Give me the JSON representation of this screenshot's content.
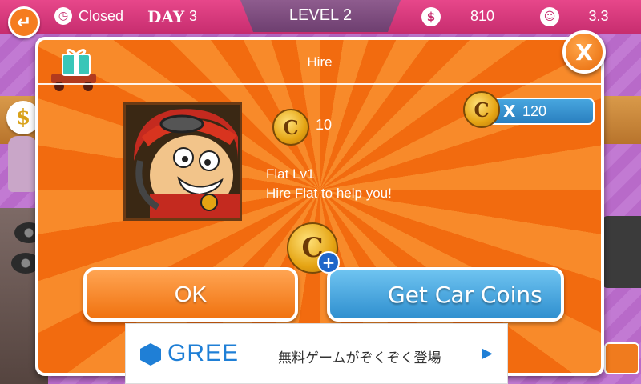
{
  "hud": {
    "status": "Closed",
    "day_label": "DAY",
    "day_number": "3",
    "level": "LEVEL 2",
    "money": "810",
    "rating": "3.3",
    "icons": {
      "back": "back-arrow-icon",
      "clock": "clock-icon",
      "money": "dollar-coin-icon",
      "rating": "smiley-icon"
    }
  },
  "dialog": {
    "title": "Hire",
    "cost": "10",
    "balance_prefix": "X",
    "balance": "120",
    "coin_symbol": "C",
    "hire_name": "Flat Lv1",
    "hire_description": "Hire Flat to help you!",
    "close_label": "X",
    "ok_label": "OK",
    "get_coins_label": "Get Car Coins"
  },
  "ad": {
    "logo": "GREE",
    "text": "無料ゲームがぞくぞく登場",
    "arrow": "▶"
  },
  "background": {
    "dollar_bubble": "$"
  },
  "colors": {
    "hud_pink": "#d23a7c",
    "dialog_orange": "#f26b0f",
    "button_blue": "#2f8fcf",
    "coin_gold": "#e5a413"
  }
}
